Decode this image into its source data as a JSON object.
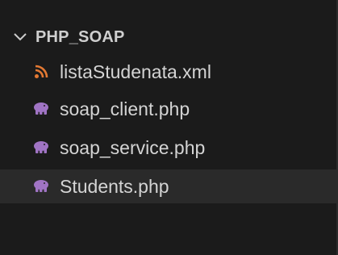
{
  "explorer": {
    "folder": {
      "name": "PHP_SOAP",
      "expanded": true,
      "chevron_icon": "chevron-down-icon"
    },
    "files": [
      {
        "name": "listaStudenata.xml",
        "icon": "rss-icon",
        "icon_color": "#e37933",
        "selected": false
      },
      {
        "name": "soap_client.php",
        "icon": "php-elephant-icon",
        "icon_color": "#a074c4",
        "selected": false
      },
      {
        "name": "soap_service.php",
        "icon": "php-elephant-icon",
        "icon_color": "#a074c4",
        "selected": false
      },
      {
        "name": "Students.php",
        "icon": "php-elephant-icon",
        "icon_color": "#a074c4",
        "selected": true
      }
    ],
    "colors": {
      "background": "#1b1b1b",
      "selected_row": "#2a2a2a",
      "text": "#d4d4d4"
    }
  }
}
